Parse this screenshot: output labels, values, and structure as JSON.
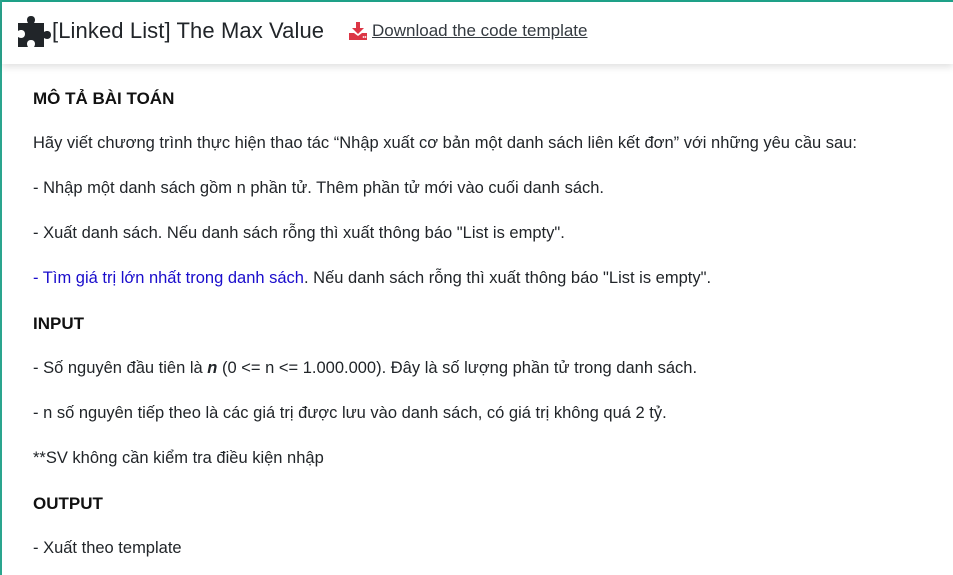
{
  "header": {
    "title": "[Linked List] The Max Value",
    "title_icon": "puzzle-piece-icon",
    "download_label": "Download the code template",
    "download_icon": "download-icon",
    "download_icon_color": "#dc3545",
    "accent_color": "#1fa38a"
  },
  "content": {
    "desc_heading": "MÔ TẢ BÀI TOÁN",
    "desc_intro": "Hãy viết chương trình thực hiện thao tác “Nhập xuất cơ bản một danh sách liên kết đơn” với những yêu cầu sau:",
    "req1": "- Nhập một danh sách gồm n phần tử. Thêm phần tử mới vào cuối danh sách.",
    "req2": "- Xuất danh sách. Nếu danh sách rỗng thì xuất thông báo \"List is empty\".",
    "req3_highlight": "- Tìm giá trị lớn nhất trong danh sách",
    "req3_rest": ". Nếu danh sách rỗng thì xuất thông báo \"List is empty\".",
    "input_heading": "INPUT",
    "input1_prefix": " - Số nguyên đầu tiên là ",
    "input1_var": "n",
    "input1_suffix": " (0 <= n <= 1.000.000). Đây là số lượng phần tử trong danh sách.",
    "input2": "- n số nguyên tiếp theo là các giá trị được lưu vào danh sách, có giá trị không quá 2 tỷ.",
    "input_note": " **SV không cần kiểm tra điều kiện nhập",
    "output_heading": "OUTPUT",
    "output1": "- Xuất theo template"
  }
}
